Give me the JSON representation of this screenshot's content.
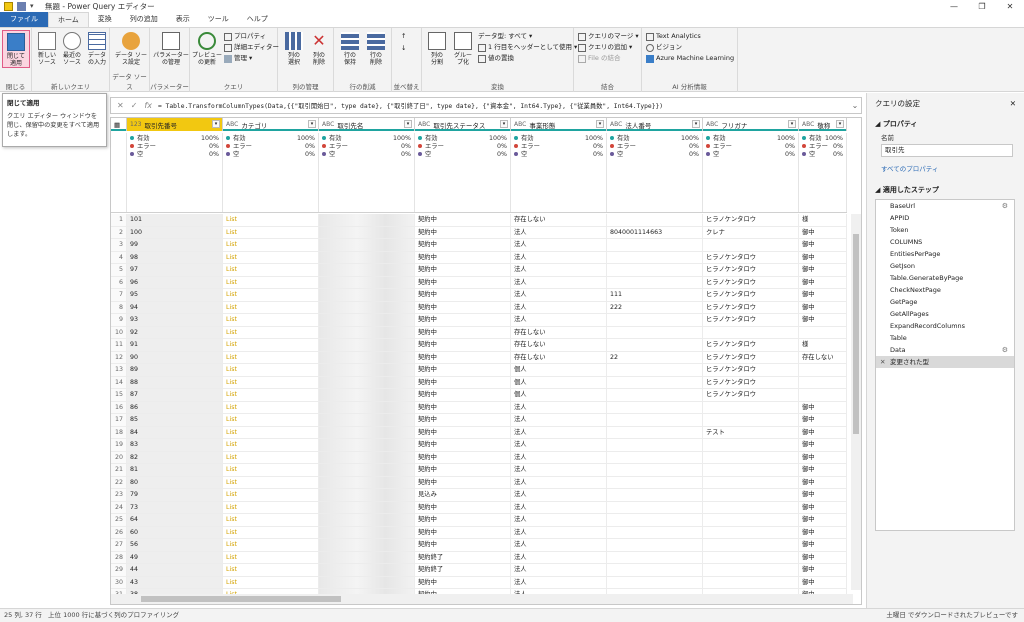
{
  "window": {
    "title": "無題 - Power Query エディター",
    "controls": [
      "—",
      "❐",
      "✕"
    ]
  },
  "tabs": [
    "ファイル",
    "ホーム",
    "変換",
    "列の追加",
    "表示",
    "ツール",
    "ヘルプ"
  ],
  "ribbon": {
    "groups": [
      {
        "name": "閉じる",
        "buttons": [
          "閉じて\n適用"
        ]
      },
      {
        "name": "新しいクエリ",
        "buttons": [
          "新しい\nソース",
          "最近の\nソース",
          "データ\nの入力"
        ]
      },
      {
        "name": "データ ソース",
        "buttons": [
          "データ ソー\nス設定"
        ]
      },
      {
        "name": "パラメーター",
        "buttons": [
          "パラメーター\nの管理"
        ]
      },
      {
        "name": "クエリ",
        "buttons": [
          "プレビュー\nの更新"
        ],
        "small": [
          "プロパティ",
          "詳細エディター",
          "管理"
        ]
      },
      {
        "name": "列の管理",
        "buttons": [
          "列の\n選択",
          "列の\n削除"
        ]
      },
      {
        "name": "行の削減",
        "buttons": [
          "行の\n保持",
          "行の\n削除"
        ]
      },
      {
        "name": "並べ替え",
        "buttons": []
      },
      {
        "name": "変換",
        "buttons": [
          "列の\n分割",
          "グルー\nプ化"
        ],
        "small": [
          "データ型: すべて",
          "1 行目をヘッダーとして使用",
          "値の置換"
        ]
      },
      {
        "name": "結合",
        "small": [
          "クエリのマージ",
          "クエリの追加",
          "File の結合"
        ]
      },
      {
        "name": "AI 分析情報",
        "small": [
          "Text Analytics",
          "ビジョン",
          "Azure Machine Learning"
        ]
      }
    ]
  },
  "tooltip": {
    "title": "閉じて適用",
    "body": "クエリ エディター ウィンドウを閉じ、保留中の変更をすべて適用します。"
  },
  "formula": "= Table.TransformColumnTypes(Data,{{\"取引開始日\", type date}, {\"取引終了日\", type date}, {\"資本金\", Int64.Type}, {\"従業員数\", Int64.Type}})",
  "columns": [
    {
      "name": "取引先番号",
      "type_icon": "123"
    },
    {
      "name": "カテゴリ",
      "type_icon": "ABC"
    },
    {
      "name": "取引先名",
      "type_icon": "ABC"
    },
    {
      "name": "取引先ステータス",
      "type_icon": "ABC"
    },
    {
      "name": "事業形態",
      "type_icon": "ABC"
    },
    {
      "name": "法人番号",
      "type_icon": "ABC"
    },
    {
      "name": "フリガナ",
      "type_icon": "ABC"
    },
    {
      "name": "敬称",
      "type_icon": "ABC"
    }
  ],
  "profile": {
    "labels": [
      "有効",
      "エラー",
      "空"
    ],
    "values": [
      "100%",
      "0%",
      "0%"
    ]
  },
  "rows": [
    [
      "1",
      "101",
      "List",
      "",
      "契約中",
      "存在しない",
      "",
      "ヒラノケンタロウ",
      "様"
    ],
    [
      "2",
      "100",
      "List",
      "",
      "契約中",
      "法人",
      "8040001114663",
      "クレナ",
      "御中"
    ],
    [
      "3",
      "99",
      "List",
      "",
      "契約中",
      "法人",
      "",
      "",
      "御中"
    ],
    [
      "4",
      "98",
      "List",
      "",
      "契約中",
      "法人",
      "",
      "ヒラノケンタロウ",
      "御中"
    ],
    [
      "5",
      "97",
      "List",
      "",
      "契約中",
      "法人",
      "",
      "ヒラノケンタロウ",
      "御中"
    ],
    [
      "6",
      "96",
      "List",
      "",
      "契約中",
      "法人",
      "",
      "ヒラノケンタロウ",
      "御中"
    ],
    [
      "7",
      "95",
      "List",
      "",
      "契約中",
      "法人",
      "111",
      "ヒラノケンタロウ",
      "御中"
    ],
    [
      "8",
      "94",
      "List",
      "",
      "契約中",
      "法人",
      "222",
      "ヒラノケンタロウ",
      "御中"
    ],
    [
      "9",
      "93",
      "List",
      "",
      "契約中",
      "法人",
      "",
      "ヒラノケンタロウ",
      "御中"
    ],
    [
      "10",
      "92",
      "List",
      "",
      "契約中",
      "存在しない",
      "",
      "",
      ""
    ],
    [
      "11",
      "91",
      "List",
      "",
      "契約中",
      "存在しない",
      "",
      "ヒラノケンタロウ",
      "様"
    ],
    [
      "12",
      "90",
      "List",
      "",
      "契約中",
      "存在しない",
      "22",
      "ヒラノケンタロウ",
      "存在しない"
    ],
    [
      "13",
      "89",
      "List",
      "",
      "契約中",
      "個人",
      "",
      "ヒラノケンタロウ",
      ""
    ],
    [
      "14",
      "88",
      "List",
      "",
      "契約中",
      "個人",
      "",
      "ヒラノケンタロウ",
      ""
    ],
    [
      "15",
      "87",
      "List",
      "",
      "契約中",
      "個人",
      "",
      "ヒラノケンタロウ",
      ""
    ],
    [
      "16",
      "86",
      "List",
      "",
      "契約中",
      "法人",
      "",
      "",
      "御中"
    ],
    [
      "17",
      "85",
      "List",
      "",
      "契約中",
      "法人",
      "",
      "",
      "御中"
    ],
    [
      "18",
      "84",
      "List",
      "",
      "契約中",
      "法人",
      "",
      "テスト",
      "御中"
    ],
    [
      "19",
      "83",
      "List",
      "",
      "契約中",
      "法人",
      "",
      "",
      "御中"
    ],
    [
      "20",
      "82",
      "List",
      "",
      "契約中",
      "法人",
      "",
      "",
      "御中"
    ],
    [
      "21",
      "81",
      "List",
      "",
      "契約中",
      "法人",
      "",
      "",
      "御中"
    ],
    [
      "22",
      "80",
      "List",
      "",
      "契約中",
      "法人",
      "",
      "",
      "御中"
    ],
    [
      "23",
      "79",
      "List",
      "",
      "見込み",
      "法人",
      "",
      "",
      "御中"
    ],
    [
      "24",
      "73",
      "List",
      "",
      "契約中",
      "法人",
      "",
      "",
      "御中"
    ],
    [
      "25",
      "64",
      "List",
      "",
      "契約中",
      "法人",
      "",
      "",
      "御中"
    ],
    [
      "26",
      "60",
      "List",
      "",
      "契約中",
      "法人",
      "",
      "",
      "御中"
    ],
    [
      "27",
      "56",
      "List",
      "",
      "契約中",
      "法人",
      "",
      "",
      "御中"
    ],
    [
      "28",
      "49",
      "List",
      "",
      "契約終了",
      "法人",
      "",
      "",
      "御中"
    ],
    [
      "29",
      "44",
      "List",
      "",
      "契約終了",
      "法人",
      "",
      "",
      "御中"
    ],
    [
      "30",
      "43",
      "List",
      "",
      "契約中",
      "法人",
      "",
      "",
      "御中"
    ],
    [
      "31",
      "38",
      "List",
      "",
      "契約中",
      "法人",
      "",
      "",
      "御中"
    ]
  ],
  "right_panel": {
    "title": "クエリの設定",
    "properties_title": "プロパティ",
    "name_label": "名前",
    "name_value": "取引先",
    "all_properties_link": "すべてのプロパティ",
    "steps_title": "適用したステップ",
    "steps": [
      "BaseUrl",
      "APPID",
      "Token",
      "COLUMNS",
      "EntitiesPerPage",
      "GetJson",
      "Table.GenerateByPage",
      "CheckNextPage",
      "GetPage",
      "GetAllPages",
      "ExpandRecordColumns",
      "Table",
      "Data",
      "変更された型"
    ],
    "steps_with_gear": [
      "BaseUrl",
      "Data"
    ],
    "active_step": "変更された型"
  },
  "status": {
    "cols_rows": "25 列, 37 行",
    "profiling": "上位 1000 行に基づく列のプロファイリング",
    "right": "土曜日 でダウンロードされたプレビューです"
  }
}
